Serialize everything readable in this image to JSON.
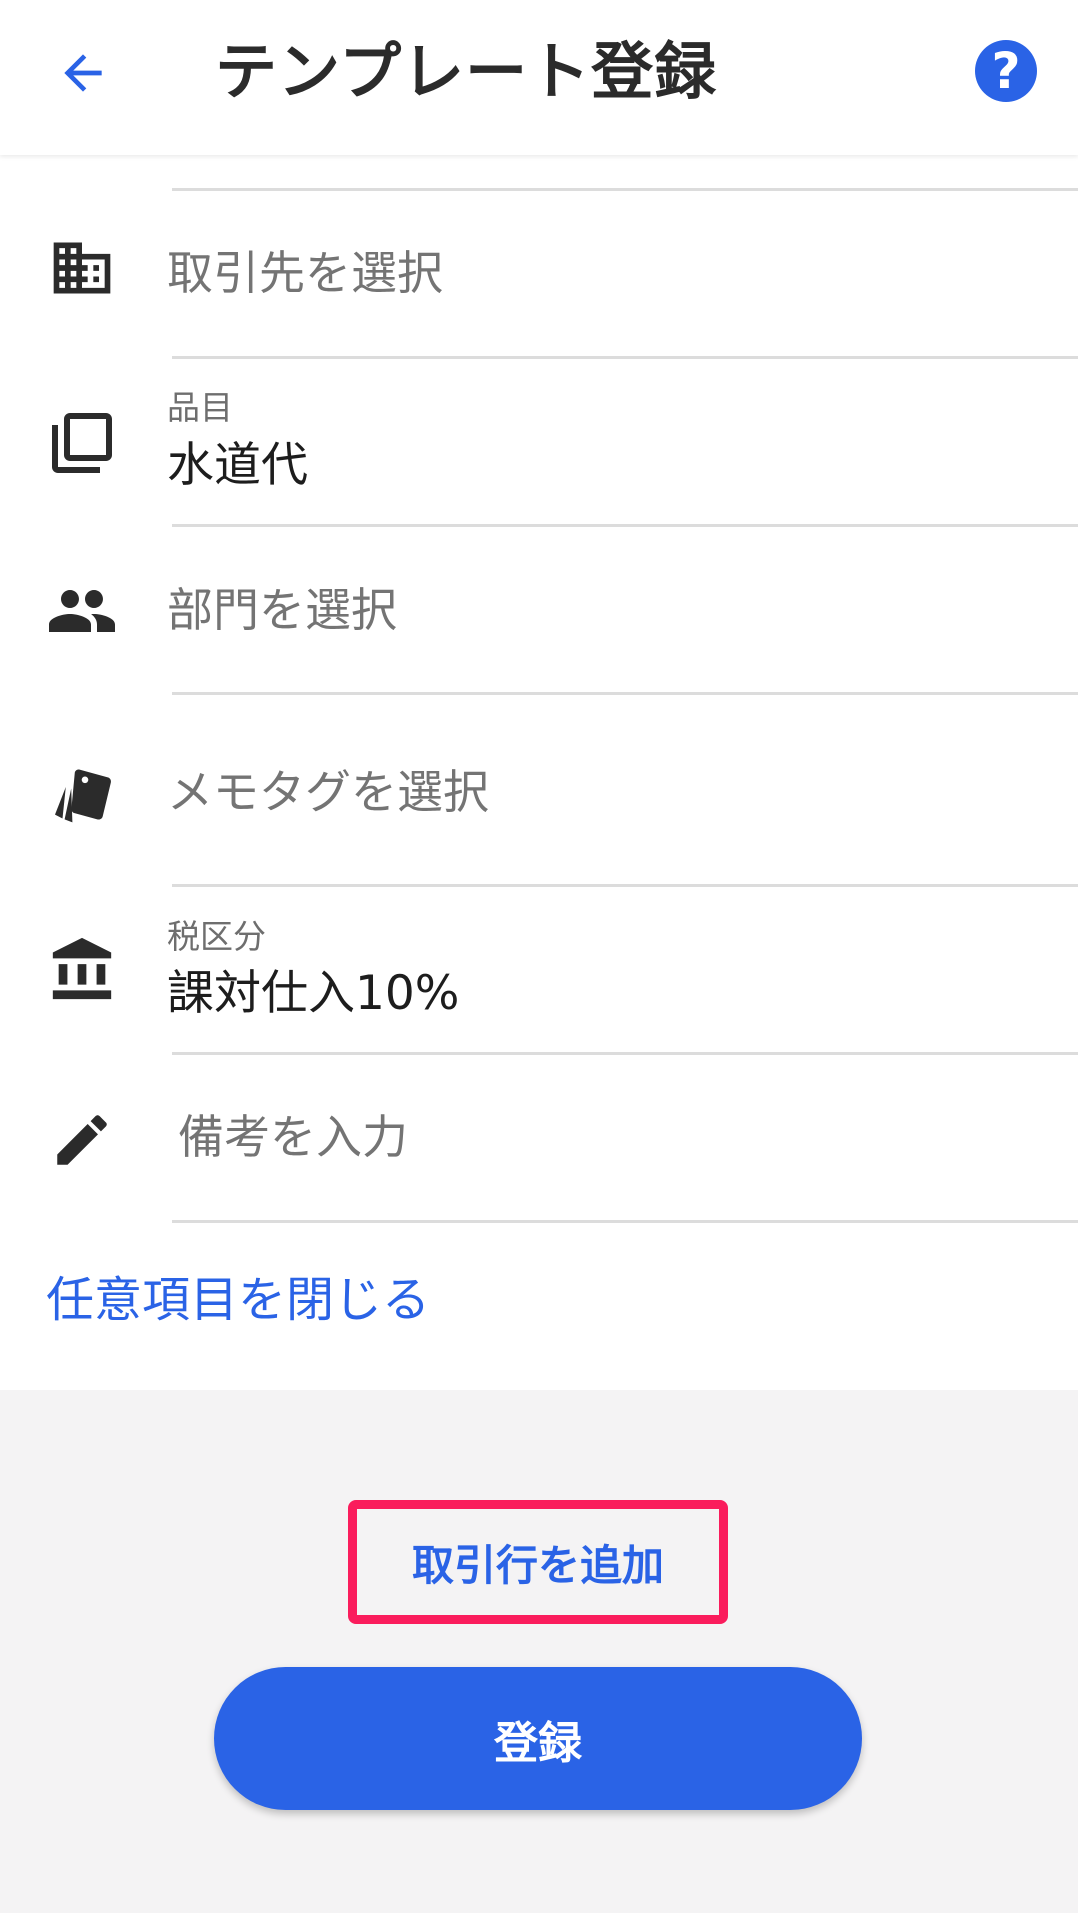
{
  "header": {
    "title": "テンプレート登録",
    "back_icon": "arrow-left-icon",
    "help_icon": "help-circle-icon",
    "help_glyph": "?"
  },
  "form": {
    "partner": {
      "icon": "building-icon",
      "placeholder": "取引先を選択"
    },
    "item": {
      "icon": "copy-icon",
      "label": "品目",
      "value": "水道代"
    },
    "department": {
      "icon": "people-icon",
      "placeholder": "部門を選択"
    },
    "memo_tag": {
      "icon": "tag-cards-icon",
      "placeholder": "メモタグを選択"
    },
    "tax": {
      "icon": "bank-icon",
      "label": "税区分",
      "value": "課対仕入10%"
    },
    "remarks": {
      "icon": "pencil-icon",
      "placeholder": "備考を入力"
    },
    "close_optional_label": "任意項目を閉じる"
  },
  "actions": {
    "add_row_label": "取引行を追加",
    "submit_label": "登録"
  },
  "colors": {
    "primary": "#2a63e6",
    "highlight": "#fa1c5c",
    "icon": "#2b2b2b"
  }
}
